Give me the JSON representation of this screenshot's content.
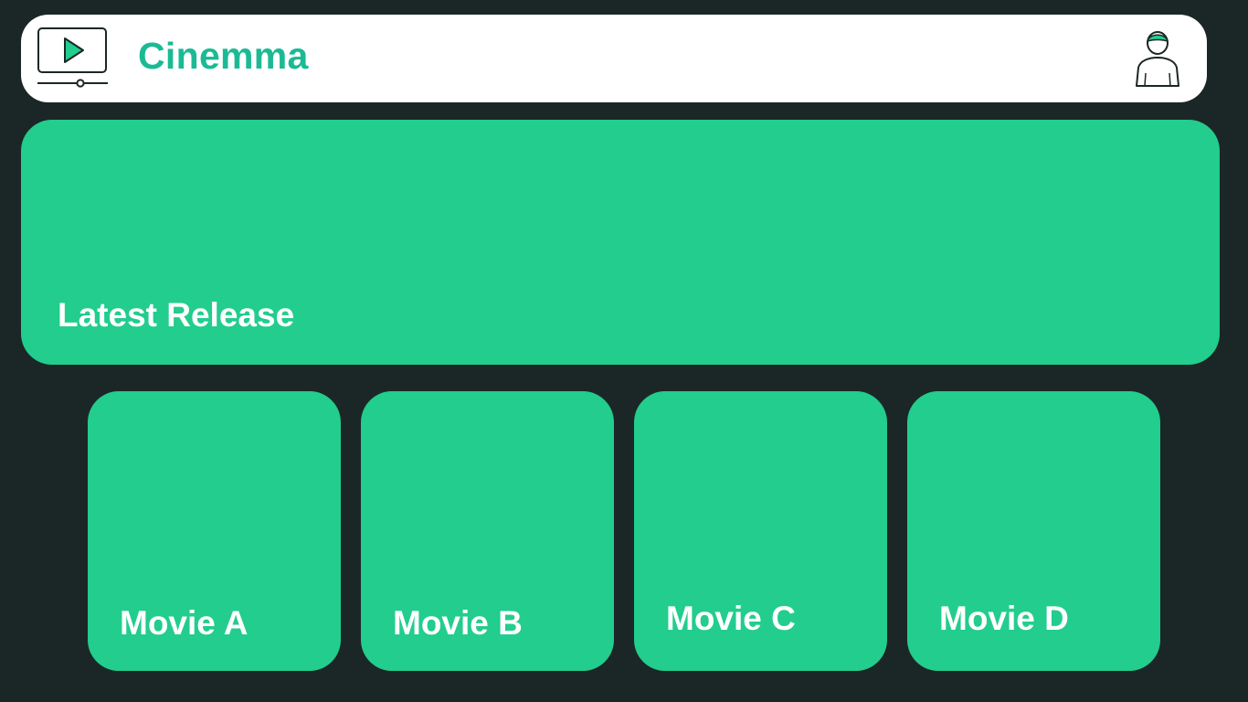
{
  "app": {
    "name": "Cinemma",
    "logo_icon": "play-monitor-icon",
    "profile_icon": "user-profile-icon"
  },
  "hero": {
    "label": "Latest Release"
  },
  "movies": [
    {
      "title": "Movie A"
    },
    {
      "title": "Movie B"
    },
    {
      "title": "Movie C"
    },
    {
      "title": "Movie D"
    }
  ],
  "colors": {
    "background": "#1b2726",
    "header": "#ffffff",
    "accent": "#22cd8d",
    "brand_text": "#1bba94"
  }
}
